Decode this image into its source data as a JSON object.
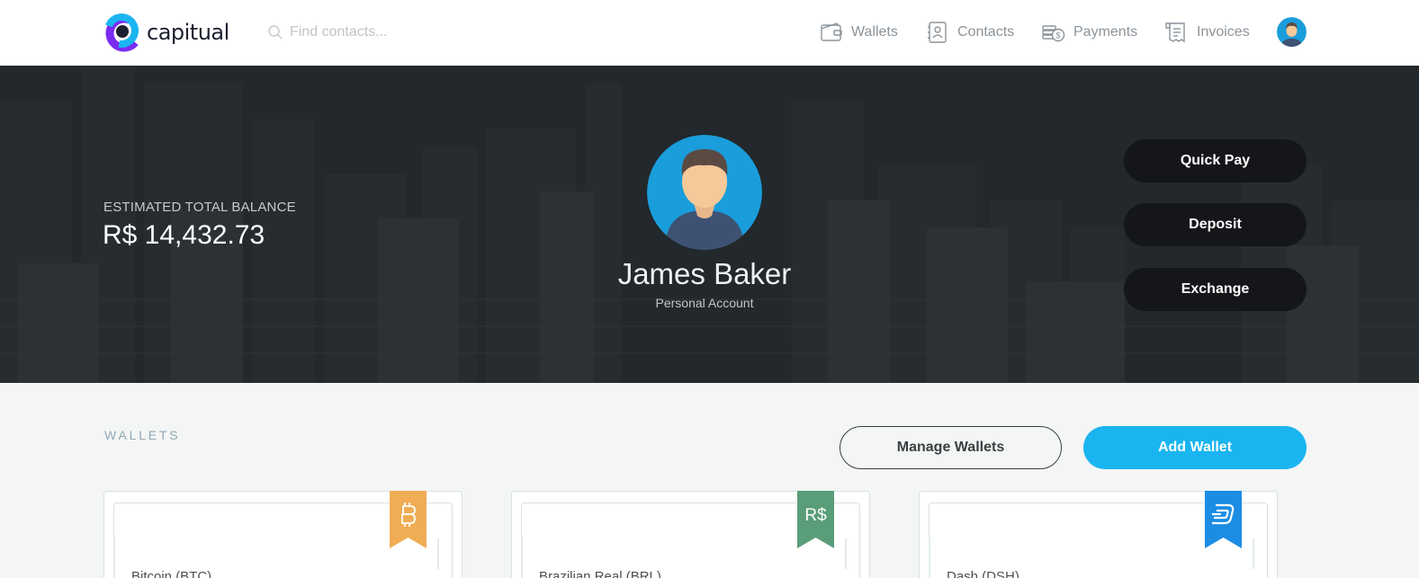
{
  "navbar": {
    "logo_text": "capitual",
    "search_placeholder": "Find contacts...",
    "items": [
      {
        "label": "Wallets",
        "icon": "wallet-icon"
      },
      {
        "label": "Contacts",
        "icon": "contacts-icon"
      },
      {
        "label": "Payments",
        "icon": "payments-icon"
      },
      {
        "label": "Invoices",
        "icon": "invoices-icon"
      }
    ]
  },
  "hero": {
    "balance_label": "ESTIMATED TOTAL BALANCE",
    "balance_value": "R$ 14,432.73",
    "user_name": "James Baker",
    "account_type": "Personal Account",
    "actions": [
      "Quick Pay",
      "Deposit",
      "Exchange"
    ]
  },
  "wallets": {
    "section_title": "WALLETS",
    "manage_label": "Manage Wallets",
    "add_label": "Add Wallet",
    "cards": [
      {
        "name": "Bitcoin (BTC)",
        "ribbon_color": "#f0ad54",
        "ribbon_symbol": "bitcoin-icon"
      },
      {
        "name": "Brazilian Real (BRL)",
        "ribbon_color": "#5a9d79",
        "ribbon_symbol": "R$"
      },
      {
        "name": "Dash (DSH)",
        "ribbon_color": "#1b8de3",
        "ribbon_symbol": "dash-icon"
      }
    ]
  },
  "colors": {
    "accent": "#1ab5f0",
    "hero_bg": "#23282c",
    "logo_blue": "#1ab5f0",
    "logo_purple": "#7b2cf0"
  }
}
